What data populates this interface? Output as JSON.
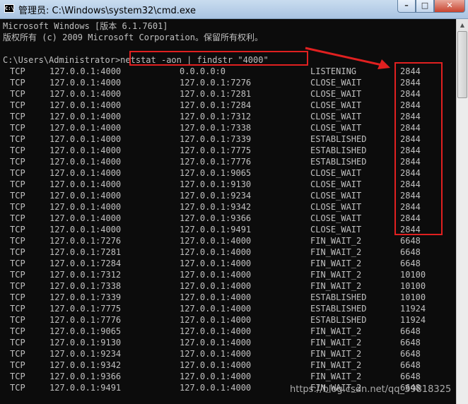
{
  "window": {
    "title": "管理员: C:\\Windows\\system32\\cmd.exe",
    "icon_text": "C:\\",
    "minimize_glyph": "–",
    "maximize_glyph": "□",
    "close_glyph": "✕",
    "icons": {
      "app": "cmd-icon",
      "min": "minimize-icon",
      "max": "maximize-icon",
      "close": "close-icon"
    }
  },
  "console": {
    "header_line1": "Microsoft Windows [版本 6.1.7601]",
    "header_line2": "版权所有 (c) 2009 Microsoft Corporation。保留所有权利。",
    "prompt": "C:\\Users\\Administrator>",
    "command": "netstat -aon | findstr \"4000\"",
    "rows": [
      {
        "proto": "TCP",
        "local": "127.0.0.1:4000",
        "remote": "0.0.0.0:0",
        "state": "LISTENING",
        "pid": "2844"
      },
      {
        "proto": "TCP",
        "local": "127.0.0.1:4000",
        "remote": "127.0.0.1:7276",
        "state": "CLOSE_WAIT",
        "pid": "2844"
      },
      {
        "proto": "TCP",
        "local": "127.0.0.1:4000",
        "remote": "127.0.0.1:7281",
        "state": "CLOSE_WAIT",
        "pid": "2844"
      },
      {
        "proto": "TCP",
        "local": "127.0.0.1:4000",
        "remote": "127.0.0.1:7284",
        "state": "CLOSE_WAIT",
        "pid": "2844"
      },
      {
        "proto": "TCP",
        "local": "127.0.0.1:4000",
        "remote": "127.0.0.1:7312",
        "state": "CLOSE_WAIT",
        "pid": "2844"
      },
      {
        "proto": "TCP",
        "local": "127.0.0.1:4000",
        "remote": "127.0.0.1:7338",
        "state": "CLOSE_WAIT",
        "pid": "2844"
      },
      {
        "proto": "TCP",
        "local": "127.0.0.1:4000",
        "remote": "127.0.0.1:7339",
        "state": "ESTABLISHED",
        "pid": "2844"
      },
      {
        "proto": "TCP",
        "local": "127.0.0.1:4000",
        "remote": "127.0.0.1:7775",
        "state": "ESTABLISHED",
        "pid": "2844"
      },
      {
        "proto": "TCP",
        "local": "127.0.0.1:4000",
        "remote": "127.0.0.1:7776",
        "state": "ESTABLISHED",
        "pid": "2844"
      },
      {
        "proto": "TCP",
        "local": "127.0.0.1:4000",
        "remote": "127.0.0.1:9065",
        "state": "CLOSE_WAIT",
        "pid": "2844"
      },
      {
        "proto": "TCP",
        "local": "127.0.0.1:4000",
        "remote": "127.0.0.1:9130",
        "state": "CLOSE_WAIT",
        "pid": "2844"
      },
      {
        "proto": "TCP",
        "local": "127.0.0.1:4000",
        "remote": "127.0.0.1:9234",
        "state": "CLOSE_WAIT",
        "pid": "2844"
      },
      {
        "proto": "TCP",
        "local": "127.0.0.1:4000",
        "remote": "127.0.0.1:9342",
        "state": "CLOSE_WAIT",
        "pid": "2844"
      },
      {
        "proto": "TCP",
        "local": "127.0.0.1:4000",
        "remote": "127.0.0.1:9366",
        "state": "CLOSE_WAIT",
        "pid": "2844"
      },
      {
        "proto": "TCP",
        "local": "127.0.0.1:4000",
        "remote": "127.0.0.1:9491",
        "state": "CLOSE_WAIT",
        "pid": "2844"
      },
      {
        "proto": "TCP",
        "local": "127.0.0.1:7276",
        "remote": "127.0.0.1:4000",
        "state": "FIN_WAIT_2",
        "pid": "6648"
      },
      {
        "proto": "TCP",
        "local": "127.0.0.1:7281",
        "remote": "127.0.0.1:4000",
        "state": "FIN_WAIT_2",
        "pid": "6648"
      },
      {
        "proto": "TCP",
        "local": "127.0.0.1:7284",
        "remote": "127.0.0.1:4000",
        "state": "FIN_WAIT_2",
        "pid": "6648"
      },
      {
        "proto": "TCP",
        "local": "127.0.0.1:7312",
        "remote": "127.0.0.1:4000",
        "state": "FIN_WAIT_2",
        "pid": "10100"
      },
      {
        "proto": "TCP",
        "local": "127.0.0.1:7338",
        "remote": "127.0.0.1:4000",
        "state": "FIN_WAIT_2",
        "pid": "10100"
      },
      {
        "proto": "TCP",
        "local": "127.0.0.1:7339",
        "remote": "127.0.0.1:4000",
        "state": "ESTABLISHED",
        "pid": "10100"
      },
      {
        "proto": "TCP",
        "local": "127.0.0.1:7775",
        "remote": "127.0.0.1:4000",
        "state": "ESTABLISHED",
        "pid": "11924"
      },
      {
        "proto": "TCP",
        "local": "127.0.0.1:7776",
        "remote": "127.0.0.1:4000",
        "state": "ESTABLISHED",
        "pid": "11924"
      },
      {
        "proto": "TCP",
        "local": "127.0.0.1:9065",
        "remote": "127.0.0.1:4000",
        "state": "FIN_WAIT_2",
        "pid": "6648"
      },
      {
        "proto": "TCP",
        "local": "127.0.0.1:9130",
        "remote": "127.0.0.1:4000",
        "state": "FIN_WAIT_2",
        "pid": "6648"
      },
      {
        "proto": "TCP",
        "local": "127.0.0.1:9234",
        "remote": "127.0.0.1:4000",
        "state": "FIN_WAIT_2",
        "pid": "6648"
      },
      {
        "proto": "TCP",
        "local": "127.0.0.1:9342",
        "remote": "127.0.0.1:4000",
        "state": "FIN_WAIT_2",
        "pid": "6648"
      },
      {
        "proto": "TCP",
        "local": "127.0.0.1:9366",
        "remote": "127.0.0.1:4000",
        "state": "FIN_WAIT_2",
        "pid": "6648"
      },
      {
        "proto": "TCP",
        "local": "127.0.0.1:9491",
        "remote": "127.0.0.1:4000",
        "state": "FIN_WAIT_2",
        "pid": "6648"
      }
    ]
  },
  "annotations": {
    "highlight_color": "#e02020"
  },
  "watermark": "https://blog.csdn.net/qq_39818325",
  "colors": {
    "console_bg": "#0c0c0c",
    "console_text": "#c0c0c0"
  }
}
